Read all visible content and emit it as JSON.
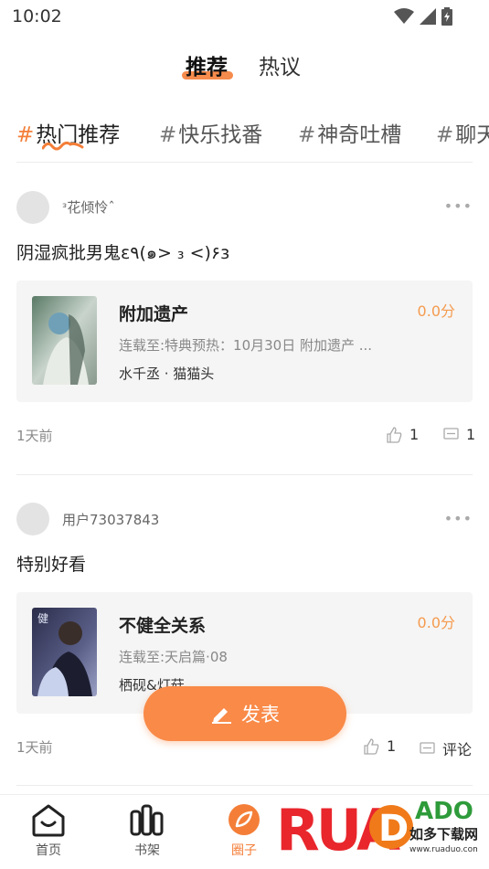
{
  "status_bar": {
    "time": "10:02"
  },
  "top_tabs": {
    "active": "推荐",
    "inactive": "热议"
  },
  "topics": [
    "热门推荐",
    "快乐找番",
    "神奇吐槽",
    "聊天"
  ],
  "posts": [
    {
      "username": "ᵌ花倾怜ˆ",
      "text": "阴湿疯批男鬼ɛ٩(๑> ₃ <)۶з",
      "book": {
        "title": "附加遗产",
        "score": "0.0分",
        "update": "连载至:特典预热：10月30日 附加遗产 ...",
        "author": "水千丞 · 猫猫头"
      },
      "time": "1天前",
      "likes": "1",
      "comments": "1"
    },
    {
      "username": "用户73037843",
      "text": "特别好看",
      "book": {
        "title": "不健全关系",
        "score": "0.0分",
        "update": "连载至:天启篇·08",
        "author": "栖砚&灯菇"
      },
      "time": "1天前",
      "likes": "1",
      "comments": "评论"
    }
  ],
  "publish_button": {
    "label": "发表"
  },
  "bottom_nav": [
    {
      "label": "首页",
      "icon": "home-icon"
    },
    {
      "label": "书架",
      "icon": "bookshelf-icon"
    },
    {
      "label": "圈子",
      "icon": "circle-icon"
    }
  ],
  "watermark": {
    "brand": "RUADADO",
    "sub": "如多下载网",
    "url": "www.ruaduo.com"
  },
  "colors": {
    "accent": "#f47e38",
    "score": "#f59b4f",
    "button": "#f98a48"
  }
}
